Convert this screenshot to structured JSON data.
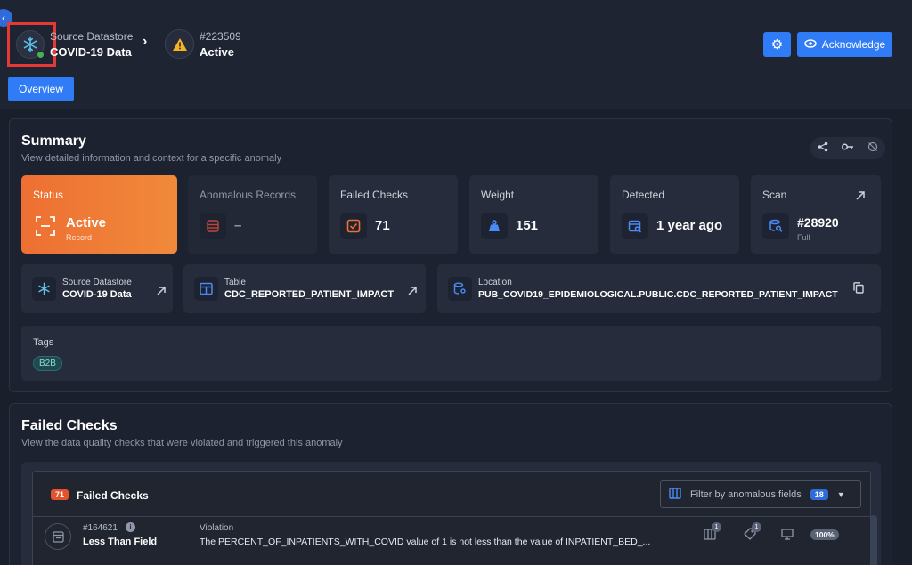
{
  "header": {
    "source_label": "Source Datastore",
    "source_name": "COVID-19 Data",
    "anomaly_id": "#223509",
    "anomaly_status": "Active",
    "acknowledge_label": "Acknowledge",
    "tab_overview": "Overview"
  },
  "summary": {
    "title": "Summary",
    "subtitle": "View detailed information and context for a specific anomaly",
    "cards": {
      "status": {
        "title": "Status",
        "value": "Active",
        "sub": "Record"
      },
      "anomalous_records": {
        "title": "Anomalous Records",
        "value": "–"
      },
      "failed_checks": {
        "title": "Failed Checks",
        "value": "71"
      },
      "weight": {
        "title": "Weight",
        "value": "151"
      },
      "detected": {
        "title": "Detected",
        "value": "1 year ago"
      },
      "scan": {
        "title": "Scan",
        "value": "#28920",
        "sub": "Full"
      }
    },
    "info": {
      "datastore": {
        "label": "Source Datastore",
        "value": "COVID-19 Data"
      },
      "table": {
        "label": "Table",
        "value": "CDC_REPORTED_PATIENT_IMPACT"
      },
      "location": {
        "label": "Location",
        "value": "PUB_COVID19_EPIDEMIOLOGICAL.PUBLIC.CDC_REPORTED_PATIENT_IMPACT"
      }
    },
    "tags_label": "Tags",
    "tags": [
      "B2B"
    ]
  },
  "failed_checks": {
    "title": "Failed Checks",
    "subtitle": "View the data quality checks that were violated and triggered this anomaly",
    "count": "71",
    "header_label": "Failed Checks",
    "filter_label": "Filter by anomalous fields",
    "filter_count": "18",
    "rows": [
      {
        "id": "#164621",
        "name": "Less Than Field",
        "violation_label": "Violation",
        "violation_text": "The PERCENT_OF_INPATIENTS_WITH_COVID value of 1 is not less than the value of INPATIENT_BED_...",
        "field_count": "1",
        "tag_count": "1",
        "coverage": "100%"
      }
    ]
  }
}
